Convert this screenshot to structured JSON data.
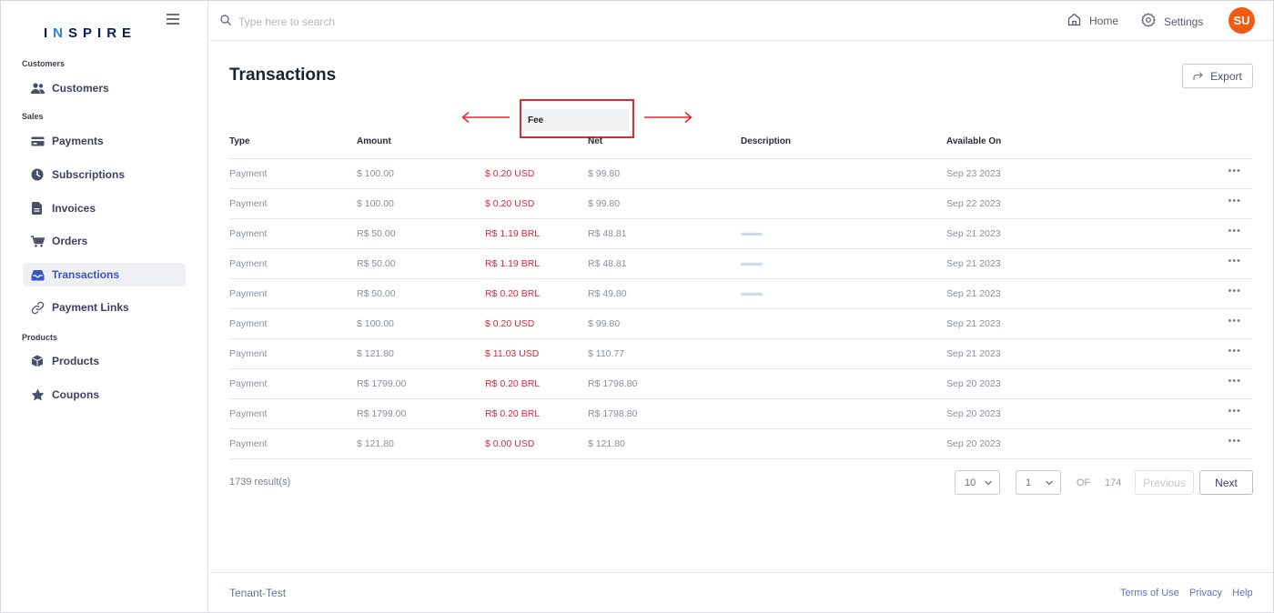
{
  "brand": {
    "prefix": "I",
    "accent_char": "N",
    "suffix": "SPIRE"
  },
  "sidebar": {
    "sections": [
      {
        "label": "Customers"
      },
      {
        "label": "Sales"
      },
      {
        "label": "Products"
      }
    ],
    "items": [
      {
        "label": "Customers",
        "icon": "users-icon"
      },
      {
        "label": "Payments",
        "icon": "credit-card-icon"
      },
      {
        "label": "Subscriptions",
        "icon": "clock-icon"
      },
      {
        "label": "Invoices",
        "icon": "document-icon"
      },
      {
        "label": "Orders",
        "icon": "cart-icon"
      },
      {
        "label": "Transactions",
        "icon": "inbox-icon",
        "active": true
      },
      {
        "label": "Payment Links",
        "icon": "link-icon"
      },
      {
        "label": "Products",
        "icon": "box-icon"
      },
      {
        "label": "Coupons",
        "icon": "star-icon"
      }
    ]
  },
  "topbar": {
    "search_placeholder": "Type here to search",
    "home_label": "Home",
    "settings_label": "Settings",
    "avatar_initials": "SU"
  },
  "page": {
    "title": "Transactions",
    "export_label": "Export"
  },
  "annotation": {
    "highlighted_column": "Fee"
  },
  "table": {
    "columns": [
      "Type",
      "Amount",
      "Net",
      "Description",
      "Available On"
    ],
    "rows": [
      {
        "type": "Payment",
        "amount": "$ 100.00",
        "fee": "$ 0.20 USD",
        "net": "$ 99.80",
        "description": "",
        "available_on": "Sep 23 2023"
      },
      {
        "type": "Payment",
        "amount": "$ 100.00",
        "fee": "$ 0.20 USD",
        "net": "$ 99.80",
        "description": "",
        "available_on": "Sep 22 2023"
      },
      {
        "type": "Payment",
        "amount": "R$ 50.00",
        "fee": "R$ 1.19 BRL",
        "net": "R$ 48.81",
        "description": "redacted",
        "available_on": "Sep 21 2023"
      },
      {
        "type": "Payment",
        "amount": "R$ 50.00",
        "fee": "R$ 1.19 BRL",
        "net": "R$ 48.81",
        "description": "redacted",
        "available_on": "Sep 21 2023"
      },
      {
        "type": "Payment",
        "amount": "R$ 50.00",
        "fee": "R$ 0.20 BRL",
        "net": "R$ 49.80",
        "description": "redacted",
        "available_on": "Sep 21 2023"
      },
      {
        "type": "Payment",
        "amount": "$ 100.00",
        "fee": "$ 0.20 USD",
        "net": "$ 99.80",
        "description": "",
        "available_on": "Sep 21 2023"
      },
      {
        "type": "Payment",
        "amount": "$ 121.80",
        "fee": "$ 11.03 USD",
        "net": "$ 110.77",
        "description": "",
        "available_on": "Sep 21 2023"
      },
      {
        "type": "Payment",
        "amount": "R$ 1799.00",
        "fee": "R$ 0.20 BRL",
        "net": "R$ 1798.80",
        "description": "",
        "available_on": "Sep 20 2023"
      },
      {
        "type": "Payment",
        "amount": "R$ 1799.00",
        "fee": "R$ 0.20 BRL",
        "net": "R$ 1798.80",
        "description": "",
        "available_on": "Sep 20 2023"
      },
      {
        "type": "Payment",
        "amount": "$ 121.80",
        "fee": "$ 0.00 USD",
        "net": "$ 121.80",
        "description": "",
        "available_on": "Sep 20 2023"
      }
    ],
    "row_menu": "•••"
  },
  "pagination": {
    "results": "1739 result(s)",
    "page_size": "10",
    "current_page": "1",
    "of_label": "OF",
    "total_pages": "174",
    "previous_label": "Previous",
    "next_label": "Next"
  },
  "footer": {
    "tenant": "Tenant-Test",
    "links": [
      "Terms of Use",
      "Privacy",
      "Help"
    ]
  },
  "colors": {
    "accent": "#3a53c9",
    "avatar": "#f05a13",
    "fee_text": "#e2233e",
    "annotation": "#e3262f"
  }
}
